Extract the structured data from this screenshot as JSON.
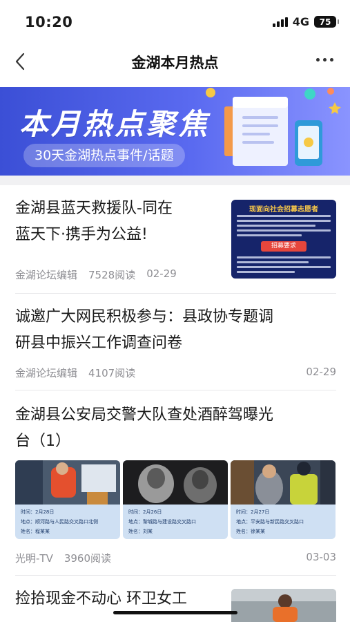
{
  "status": {
    "time": "10:20",
    "network": "4G",
    "battery": "75"
  },
  "nav": {
    "title": "金湖本月热点"
  },
  "banner": {
    "title": "本月热点聚焦",
    "subtitle": "30天金湖热点事件/话题"
  },
  "articles": [
    {
      "title_line1": "金湖县蓝天救援队-同在",
      "title_line2": "蓝天下·携手为公益!",
      "source": "金湖论坛编辑",
      "reads": "7528阅读",
      "date": "02-29",
      "thumb": {
        "header": "现面向社会招募志愿者",
        "tag": "招募要求"
      }
    },
    {
      "title_line1": "诚邀广大网民积极参与：县政协专题调",
      "title_line2": "研县中振兴工作调查问卷",
      "source": "金湖论坛编辑",
      "reads": "4107阅读",
      "date": "02-29"
    },
    {
      "title_line1": "金湖县公安局交警大队查处酒醉驾曝光",
      "title_line2": "台（1）",
      "source": "光明-TV",
      "reads": "3960阅读",
      "date": "03-03",
      "images": [
        {
          "time": "时间：2月28日",
          "place": "地点：顺河路与人民路交叉路口北侧",
          "name": "姓名：程某某"
        },
        {
          "time": "时间：2月26日",
          "place": "地点：黎城路与建设路交叉路口",
          "name": "姓名：刘某"
        },
        {
          "time": "时间：2月27日",
          "place": "地点：平安路与新民路交叉路口",
          "name": "姓名：徐某某"
        }
      ]
    },
    {
      "title_line1": "捡拾现金不动心 环卫女工"
    }
  ],
  "colors": {
    "banner_start": "#3b4fd6",
    "banner_end": "#8a94ff",
    "meta": "#8e8e93",
    "poster_bg": "#16246a"
  }
}
